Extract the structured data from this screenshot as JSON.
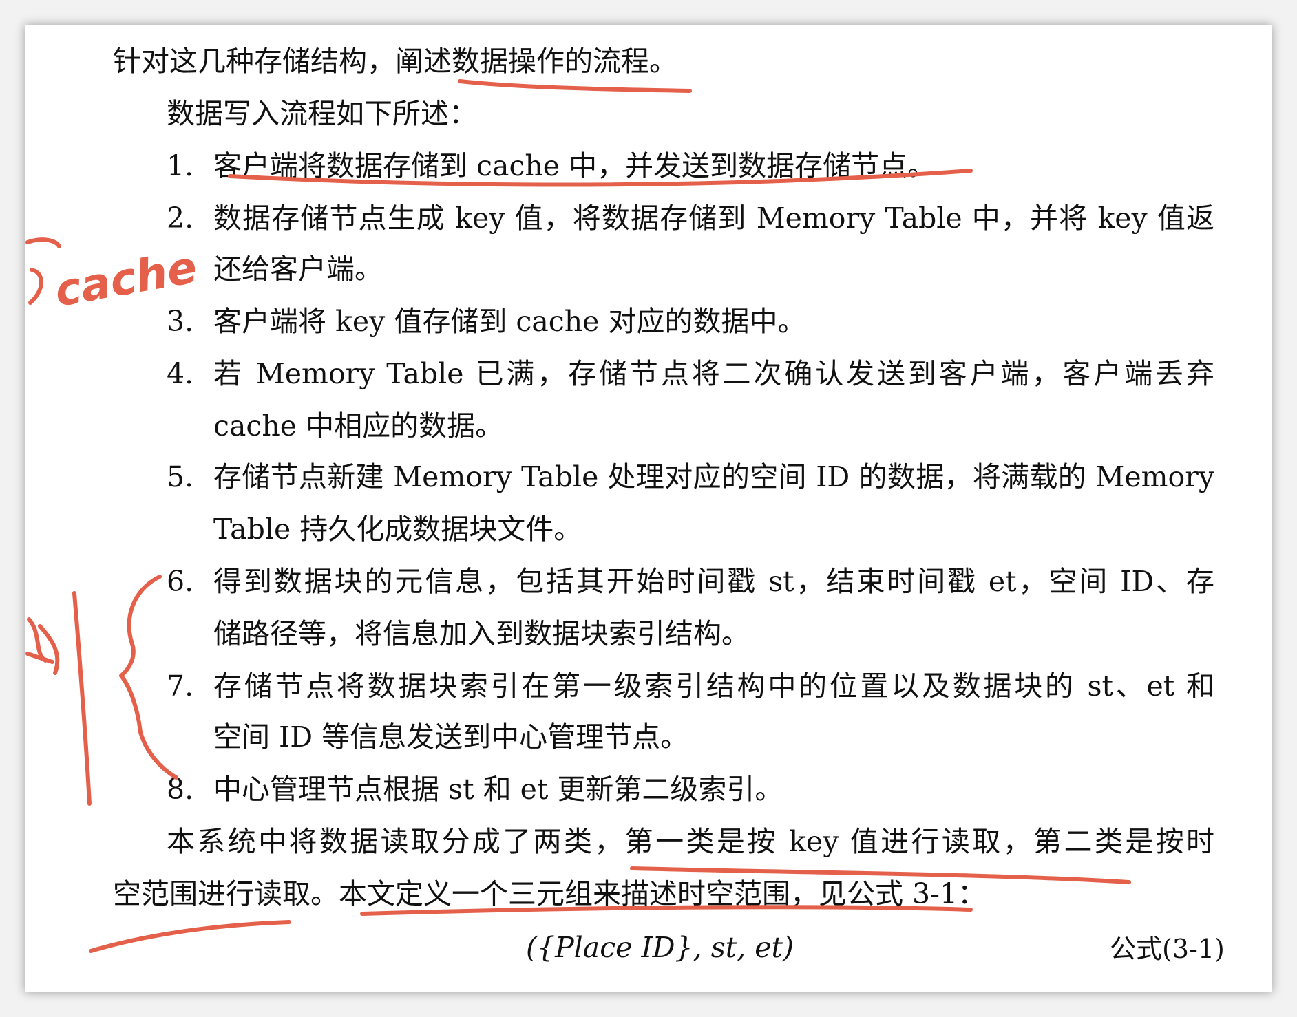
{
  "intro_line": "针对这几种存储结构，阐述数据操作的流程。",
  "write_heading": "数据写入流程如下所述：",
  "steps": [
    {
      "number": "1.",
      "lines": [
        "客户端将数据存储到 cache 中，并发送到数据存储节点。"
      ]
    },
    {
      "number": "2.",
      "lines": [
        "数据存储节点生成 key 值，将数据存储到 Memory Table 中，并将 key 值返",
        "还给客户端。"
      ]
    },
    {
      "number": "3.",
      "lines": [
        "客户端将 key 值存储到 cache 对应的数据中。"
      ]
    },
    {
      "number": "4.",
      "lines": [
        "若 Memory Table 已满，存储节点将二次确认发送到客户端，客户端丢弃",
        "cache 中相应的数据。"
      ]
    },
    {
      "number": "5.",
      "lines": [
        "存储节点新建 Memory Table 处理对应的空间 ID 的数据，将满载的 Memory",
        "Table 持久化成数据块文件。"
      ]
    },
    {
      "number": "6.",
      "lines": [
        "得到数据块的元信息，包括其开始时间戳 st，结束时间戳 et，空间 ID、存",
        "储路径等，将信息加入到数据块索引结构。"
      ]
    },
    {
      "number": "7.",
      "lines": [
        "存储节点将数据块索引在第一级索引结构中的位置以及数据块的 st、et 和",
        "空间 ID 等信息发送到中心管理节点。"
      ]
    },
    {
      "number": "8.",
      "lines": [
        "中心管理节点根据 st 和 et 更新第二级索引。"
      ]
    }
  ],
  "read_paragraph": [
    "本系统中将数据读取分成了两类，第一类是按 key 值进行读取，第二类是按时",
    "空范围进行读取。本文定义一个三元组来描述时空范围，见公式 3-1："
  ],
  "formula": "({Place ID}, st, et)",
  "formula_label": "公式(3-1)",
  "handwriting": {
    "margin_note": "cache",
    "color": "#e4604a"
  }
}
